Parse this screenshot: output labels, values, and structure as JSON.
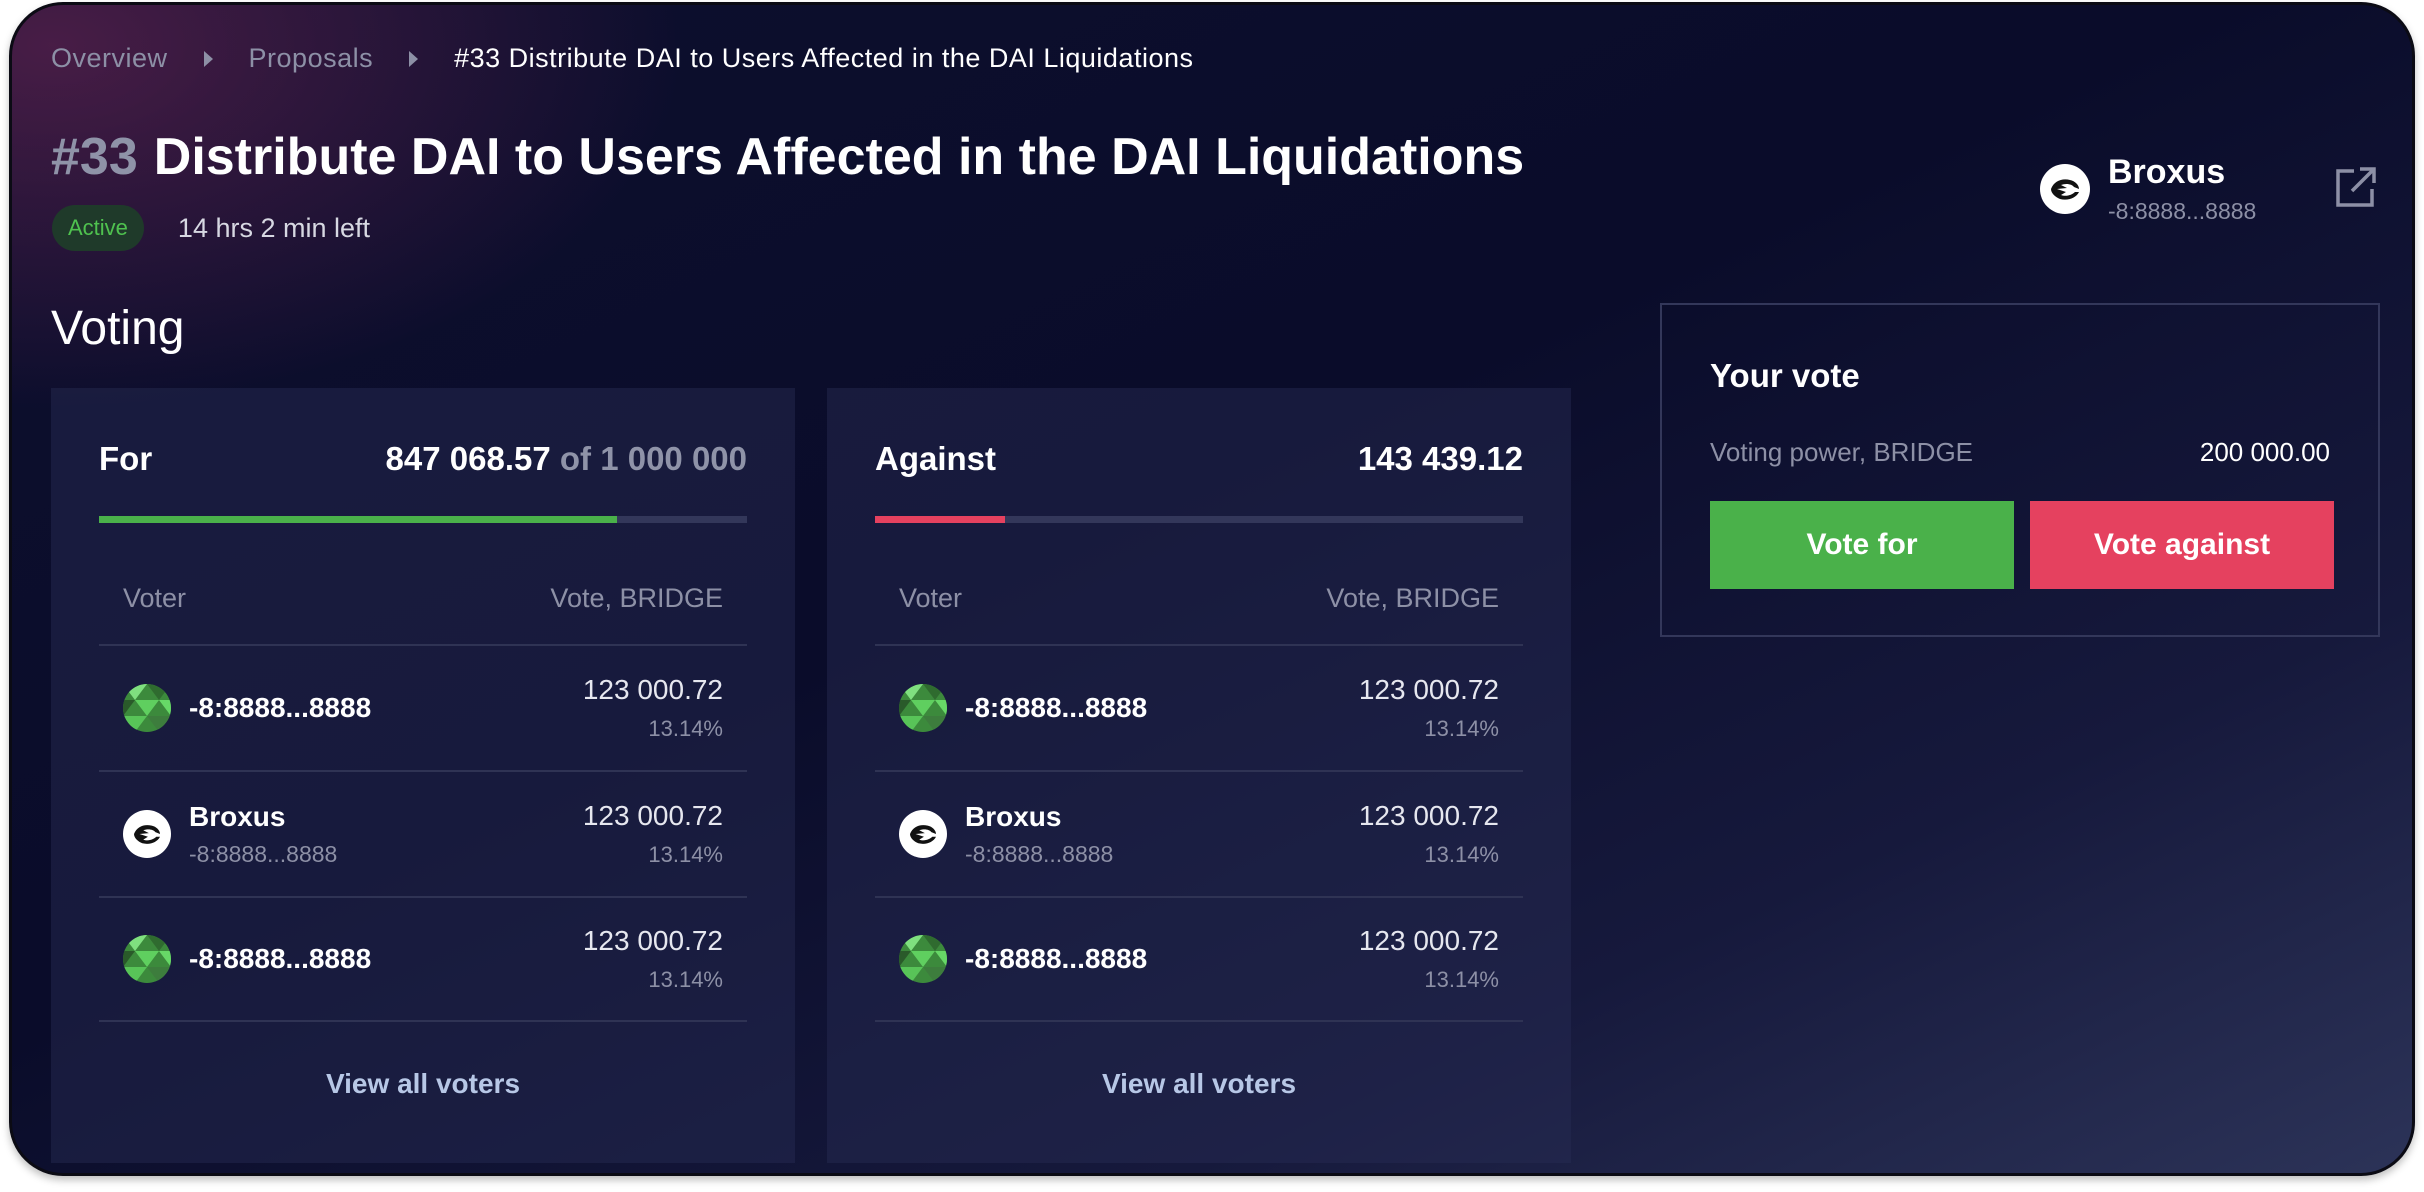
{
  "breadcrumb": {
    "items": [
      "Overview",
      "Proposals",
      "#33 Distribute DAI to Users Affected in the DAI Liquidations"
    ]
  },
  "proposal": {
    "number": "#33",
    "title": "Distribute DAI to Users Affected in the DAI Liquidations",
    "status": "Active",
    "time_left": "14 hrs 2 min left"
  },
  "author": {
    "name": "Broxus",
    "address": "-8:8888...8888"
  },
  "section_title": "Voting",
  "for_card": {
    "label": "For",
    "total": "847 068.57",
    "of_text": "of 1 000 000",
    "progress": 0.8,
    "bar_color": "#4ab14a",
    "columns": [
      "Voter",
      "Vote, BRIDGE"
    ],
    "rows": [
      {
        "name": "-8:8888...8888",
        "sub": "",
        "amount": "123 000.72",
        "pct": "13.14%",
        "avatar": "green-pattern"
      },
      {
        "name": "Broxus",
        "sub": "-8:8888...8888",
        "amount": "123 000.72",
        "pct": "13.14%",
        "avatar": "broxus-logo"
      },
      {
        "name": "-8:8888...8888",
        "sub": "",
        "amount": "123 000.72",
        "pct": "13.14%",
        "avatar": "green-pattern"
      }
    ],
    "view_all": "View all voters"
  },
  "against_card": {
    "label": "Against",
    "total": "143 439.12",
    "progress": 0.2,
    "bar_color": "#e5415f",
    "columns": [
      "Voter",
      "Vote, BRIDGE"
    ],
    "rows": [
      {
        "name": "-8:8888...8888",
        "sub": "",
        "amount": "123 000.72",
        "pct": "13.14%",
        "avatar": "green-pattern"
      },
      {
        "name": "Broxus",
        "sub": "-8:8888...8888",
        "amount": "123 000.72",
        "pct": "13.14%",
        "avatar": "broxus-logo"
      },
      {
        "name": "-8:8888...8888",
        "sub": "",
        "amount": "123 000.72",
        "pct": "13.14%",
        "avatar": "green-pattern"
      }
    ],
    "view_all": "View all voters"
  },
  "your_vote": {
    "title": "Your vote",
    "power_label": "Voting power, BRIDGE",
    "power_value": "200 000.00",
    "vote_for": "Vote for",
    "vote_against": "Vote against"
  },
  "colors": {
    "accent_green": "#4ab14a",
    "accent_red": "#e5415f",
    "muted_text": "#8d90a6"
  }
}
